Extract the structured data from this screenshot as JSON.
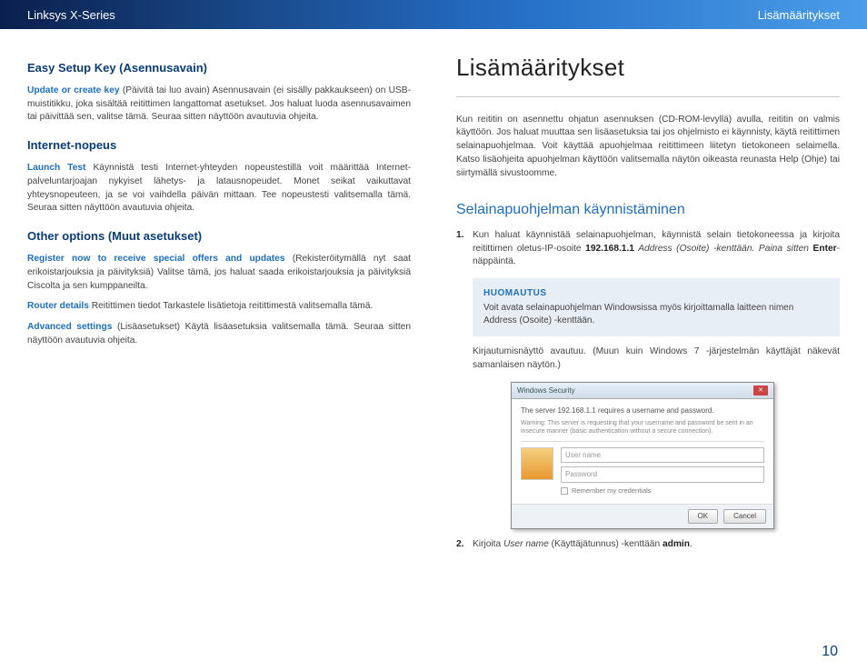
{
  "header": {
    "left": "Linksys X-Series",
    "right": "Lisämääritykset"
  },
  "left_col": {
    "s1_title": "Easy Setup Key (Asennusavain)",
    "s1_kw": "Update or create key",
    "s1_body": " (Päivitä tai luo avain) Asennusavain (ei sisälly pakkaukseen) on USB-muistitikku, joka sisältää reitittimen langattomat asetukset. Jos haluat luoda asennusavaimen tai päivittää sen, valitse tämä. Seuraa sitten näyttöön avautuvia ohjeita.",
    "s2_title": "Internet-nopeus",
    "s2_kw": "Launch Test",
    "s2_body": " Käynnistä testi Internet-yhteyden nopeustestillä voit määrittää Internet-palveluntarjoajan nykyiset lähetys- ja latausnopeudet. Monet seikat vaikuttavat yhteysnopeuteen, ja se voi vaihdella päivän mittaan. Tee nopeustesti valitsemalla tämä. Seuraa sitten näyttöön avautuvia ohjeita.",
    "s3_title": "Other options (Muut asetukset)",
    "s3_kw1": "Register now to receive special offers and updates",
    "s3_body1": " (Rekisteröitymällä nyt saat erikoistarjouksia ja päivityksiä) Valitse tämä, jos haluat saada erikoistarjouksia ja päivityksiä Ciscolta ja sen kumppaneilta.",
    "s3_kw2": "Router details",
    "s3_body2": " Reitittimen tiedot Tarkastele lisätietoja reitittimestä valitsemalla tämä.",
    "s3_kw3": "Advanced settings",
    "s3_body3": " (Lisäasetukset) Käytä lisäasetuksia valitsemalla tämä. Seuraa sitten näyttöön avautuvia ohjeita."
  },
  "right_col": {
    "title": "Lisämääritykset",
    "intro": "Kun reititin on asennettu ohjatun asennuksen (CD-ROM-levyllä) avulla, reititin on valmis käyttöön. Jos haluat muuttaa sen lisäasetuksia tai jos ohjelmisto ei käynnisty, käytä reitittimen selainapuohjelmaa. Voit käyttää apuohjelmaa reitittimeen liitetyn tietokoneen selaimella. Katso lisäohjeita apuohjelman käyttöön valitsemalla näytön oikeasta reunasta Help (Ohje) tai siirtymällä sivustoomme.",
    "h2": "Selainapuohjelman käynnistäminen",
    "step1_pre": "Kun haluat käynnistää selainapuohjelman, käynnistä selain tietokoneessa ja kirjoita reitittimen oletus-IP-osoite ",
    "step1_ip": "192.168.1.1",
    "step1_mid": " Address (Osoite) -kenttään. Paina sitten ",
    "step1_enter": "Enter",
    "step1_post": "-näppäintä.",
    "notice_title": "HUOMAUTUS",
    "notice_body": "Voit avata selainapuohjelman Windowsissa myös kirjoittamalla laitteen nimen Address (Osoite) -kenttään.",
    "login_note": "Kirjautumisnäyttö avautuu. (Muun kuin Windows 7 -järjestelmän käyttäjät näkevät samanlaisen näytön.)",
    "step2_pre": "Kirjoita ",
    "step2_field": "User name",
    "step2_mid": " (Käyttäjätunnus) -kenttään ",
    "step2_val": "admin",
    "step2_post": "."
  },
  "dialog": {
    "title": "Windows Security",
    "msg": "The server 192.168.1.1 requires a username and password.",
    "warn": "Warning: This server is requesting that your username and password be sent in an insecure manner (basic authentication without a secure connection).",
    "user_ph": "User name",
    "pass_ph": "Password",
    "remember": "Remember my credentials",
    "ok": "OK",
    "cancel": "Cancel"
  },
  "page_number": "10"
}
